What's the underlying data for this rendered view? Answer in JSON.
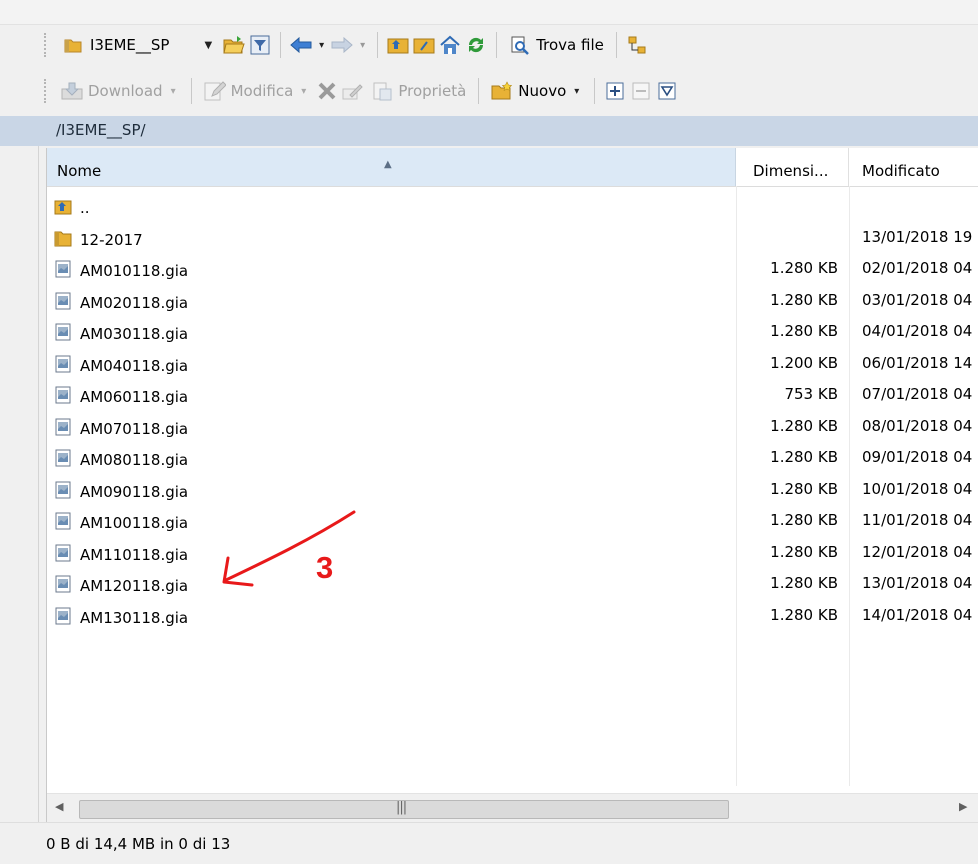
{
  "toolbar": {
    "location": "I3EME__SP",
    "find_files": "Trova file",
    "download": "Download",
    "edit": "Modifica",
    "properties": "Proprietà",
    "new": "Nuovo"
  },
  "pathbar": {
    "path": "/I3EME__SP/"
  },
  "filelist": {
    "columns": {
      "name": "Nome",
      "size": "Dimensi...",
      "modified": "Modificato"
    },
    "rows": [
      {
        "name": "..",
        "size": "",
        "modified": "",
        "icon": "parent-folder-icon"
      },
      {
        "name": "12-2017",
        "size": "",
        "modified": "13/01/2018 19",
        "icon": "folder-icon"
      },
      {
        "name": "AM010118.gia",
        "size": "1.280 KB",
        "modified": "02/01/2018 04",
        "icon": "file-icon"
      },
      {
        "name": "AM020118.gia",
        "size": "1.280 KB",
        "modified": "03/01/2018 04",
        "icon": "file-icon"
      },
      {
        "name": "AM030118.gia",
        "size": "1.280 KB",
        "modified": "04/01/2018 04",
        "icon": "file-icon"
      },
      {
        "name": "AM040118.gia",
        "size": "1.200 KB",
        "modified": "06/01/2018 14",
        "icon": "file-icon"
      },
      {
        "name": "AM060118.gia",
        "size": "753 KB",
        "modified": "07/01/2018 04",
        "icon": "file-icon"
      },
      {
        "name": "AM070118.gia",
        "size": "1.280 KB",
        "modified": "08/01/2018 04",
        "icon": "file-icon"
      },
      {
        "name": "AM080118.gia",
        "size": "1.280 KB",
        "modified": "09/01/2018 04",
        "icon": "file-icon"
      },
      {
        "name": "AM090118.gia",
        "size": "1.280 KB",
        "modified": "10/01/2018 04",
        "icon": "file-icon"
      },
      {
        "name": "AM100118.gia",
        "size": "1.280 KB",
        "modified": "11/01/2018 04",
        "icon": "file-icon"
      },
      {
        "name": "AM110118.gia",
        "size": "1.280 KB",
        "modified": "12/01/2018 04",
        "icon": "file-icon"
      },
      {
        "name": "AM120118.gia",
        "size": "1.280 KB",
        "modified": "13/01/2018 04",
        "icon": "file-icon"
      },
      {
        "name": "AM130118.gia",
        "size": "1.280 KB",
        "modified": "14/01/2018 04",
        "icon": "file-icon"
      }
    ]
  },
  "annotation": {
    "label": "3",
    "color": "#e8191a"
  },
  "status": {
    "text": "0 B di 14,4 MB in 0 di 13"
  },
  "colors": {
    "path_bar": "#c9d6e6",
    "header_highlight": "#dce9f6",
    "folder": "#e8b236"
  }
}
